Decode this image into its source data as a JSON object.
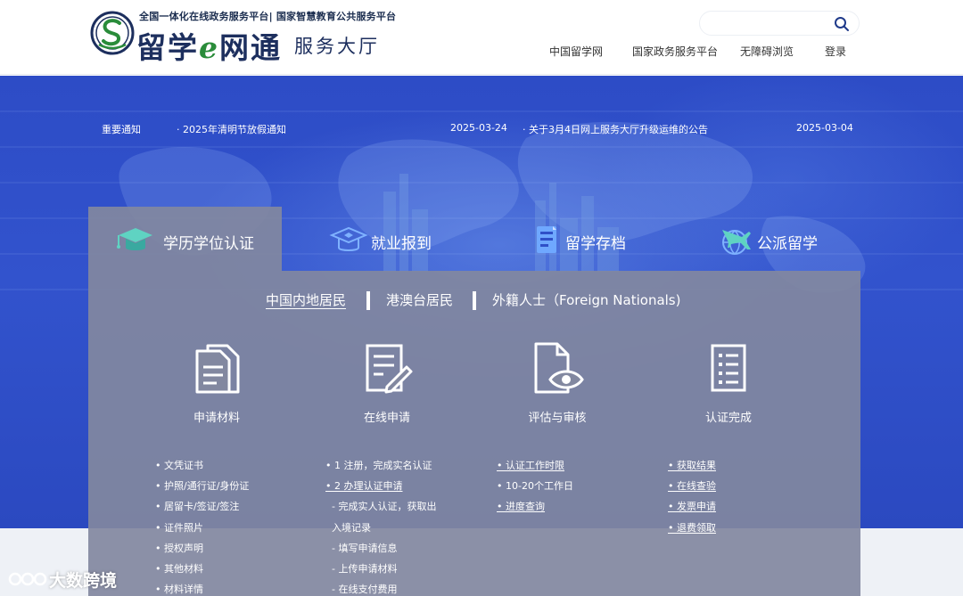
{
  "header": {
    "tagline": "全国一体化在线政务服务平台| 国家智慧教育公共服务平台",
    "brand_part1": "留学",
    "brand_e": "e",
    "brand_part2": "网通",
    "brand_sub": "服务大厅",
    "search_placeholder": "",
    "nav": [
      "中国留学网",
      "国家政务服务平台",
      "无障碍浏览",
      "登录"
    ]
  },
  "notices": {
    "label": "重要通知",
    "items": [
      {
        "title": "· 2025年清明节放假通知",
        "date": "2025-03-24"
      },
      {
        "title": "· 关于3月4日网上服务大厅升级运维的公告",
        "date": "2025-03-04"
      }
    ]
  },
  "tabs": [
    {
      "label": "学历学位认证",
      "icon": "graduation-cap-icon",
      "active": true
    },
    {
      "label": "就业报到",
      "icon": "employment-cap-icon",
      "active": false
    },
    {
      "label": "留学存档",
      "icon": "archive-folder-icon",
      "active": false
    },
    {
      "label": "公派留学",
      "icon": "airplane-globe-icon",
      "active": false
    }
  ],
  "subtabs": [
    "中国内地居民",
    "港澳台居民",
    "外籍人士（Foreign Nationals)"
  ],
  "steps": [
    {
      "label": "申请材料",
      "icon": "documents-icon"
    },
    {
      "label": "在线申请",
      "icon": "form-edit-icon"
    },
    {
      "label": "评估与审核",
      "icon": "document-eye-icon"
    },
    {
      "label": "认证完成",
      "icon": "checklist-icon"
    }
  ],
  "columns": [
    [
      "• 文凭证书",
      "• 护照/通行证/身份证",
      "• 居留卡/签证/签注",
      "• 证件照片",
      "• 授权声明",
      "• 其他材料",
      "• 材料详情"
    ],
    [
      "• 1 注册，完成实名认证",
      "• 2 办理认证申请",
      "  - 完成实人认证，获取出",
      "  入境记录",
      "  - 填写申请信息",
      "  - 上传申请材料",
      "  - 在线支付费用"
    ],
    [
      "• 认证工作时限",
      "• 10-20个工作日",
      "• 进度查询"
    ],
    [
      "• 获取结果",
      "• 在线查验",
      "• 发票申请",
      "• 退费领取"
    ]
  ],
  "watermark": "大数跨境",
  "colors": {
    "hero_blue": "#2f50c8",
    "panel_gray": "#8288a0",
    "brand_navy": "#1d2f5e",
    "brand_green": "#2a8c3a"
  }
}
